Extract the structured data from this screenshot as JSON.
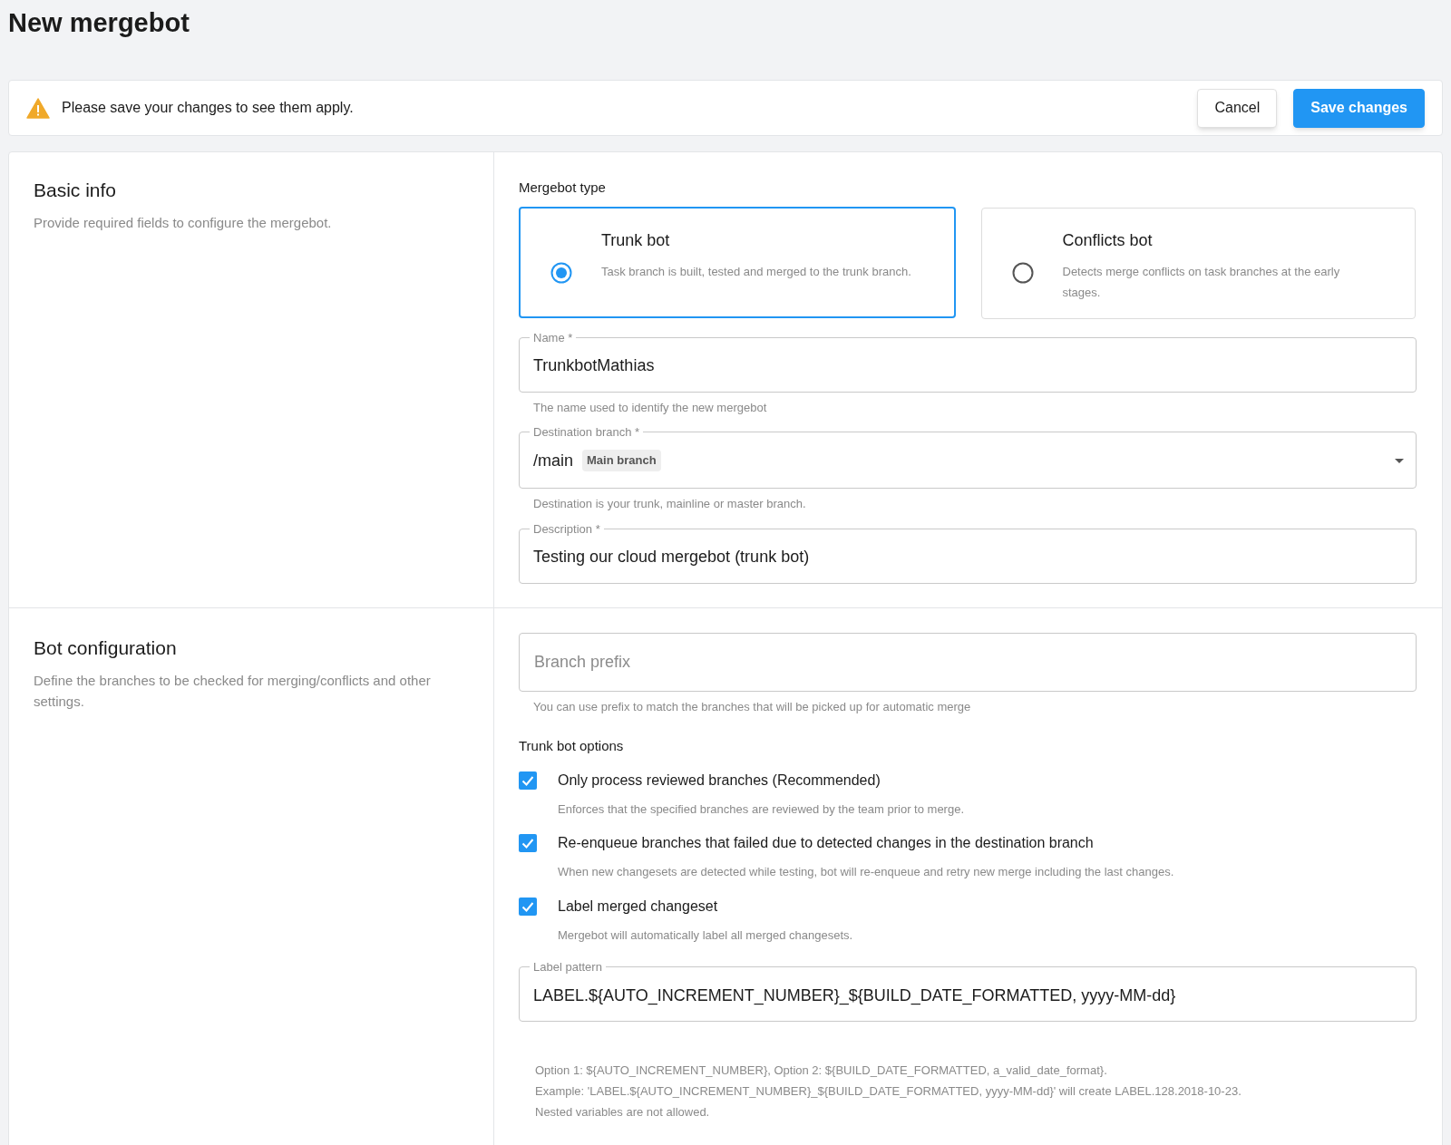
{
  "page": {
    "title": "New mergebot"
  },
  "banner": {
    "message": "Please save your changes to see them apply.",
    "buttons": [
      {
        "label": "Cancel",
        "kind": "secondary"
      },
      {
        "label": "Save changes",
        "kind": "primary"
      }
    ]
  },
  "basic_info": {
    "title": "Basic info",
    "description": "Provide required fields to configure the mergebot.",
    "type_label": "Mergebot type",
    "types": [
      {
        "title": "Trunk bot",
        "description": "Task branch is built, tested and merged to the trunk branch.",
        "selected": true
      },
      {
        "title": "Conflicts bot",
        "description": "Detects merge conflicts on task branches at the early stages.",
        "selected": false
      }
    ],
    "fields": [
      {
        "kind": "text",
        "label": "Name *",
        "value": "TrunkbotMathias",
        "hint": "The name used to identify the new mergebot"
      },
      {
        "kind": "select",
        "label": "Destination branch *",
        "value": "/main",
        "tag": "Main branch",
        "hint": "Destination is your trunk, mainline or master branch."
      },
      {
        "kind": "text",
        "label": "Description *",
        "value": "Testing our cloud mergebot (trunk bot)"
      }
    ]
  },
  "bot_configuration": {
    "title": "Bot configuration",
    "description": "Define the branches to be checked for merging/conflicts and other settings.",
    "branch_prefix": {
      "placeholder": "Branch prefix",
      "hint": "You can use prefix to match the branches that will be picked up for automatic merge"
    },
    "options_title": "Trunk bot options",
    "options": [
      {
        "label": "Only process reviewed branches (Recommended)",
        "hint": "Enforces that the specified branches are reviewed by the team prior to merge.",
        "checked": true
      },
      {
        "label": "Re-enqueue branches that failed due to detected changes in the destination branch",
        "hint": "When new changesets are detected while testing, bot will re-enqueue and retry new merge including the last changes.",
        "checked": true
      },
      {
        "label": "Label merged changeset",
        "hint": "Mergebot will automatically label all merged changesets.",
        "checked": true
      }
    ],
    "label_pattern": {
      "label": "Label pattern",
      "value": "LABEL.${AUTO_INCREMENT_NUMBER}_${BUILD_DATE_FORMATTED, yyyy-MM-dd}"
    },
    "notes": [
      "Option 1: ${AUTO_INCREMENT_NUMBER}, Option 2: ${BUILD_DATE_FORMATTED, a_valid_date_format}.",
      "Example: 'LABEL.${AUTO_INCREMENT_NUMBER}_${BUILD_DATE_FORMATTED, yyyy-MM-dd}' will create LABEL.128.2018-10-23.",
      "Nested variables are not allowed."
    ]
  }
}
